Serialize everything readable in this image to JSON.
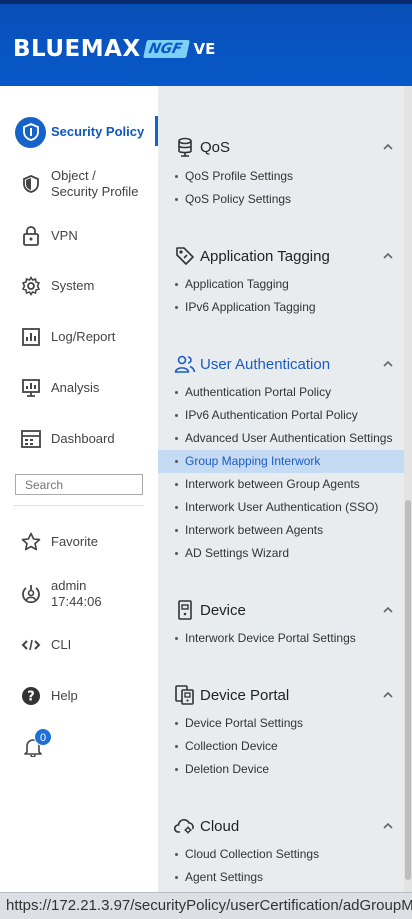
{
  "header": {
    "logo_main": "BLUEMAX",
    "logo_ngf": "NGF",
    "logo_ve": "VE"
  },
  "sidebar": {
    "items": [
      {
        "label": "Security Policy",
        "icon": "shield-icon"
      },
      {
        "label_line1": "Object /",
        "label_line2": "Security Profile",
        "icon": "object-shield-icon"
      },
      {
        "label": "VPN",
        "icon": "lock-icon"
      },
      {
        "label": "System",
        "icon": "gear-icon"
      },
      {
        "label": "Log/Report",
        "icon": "report-icon"
      },
      {
        "label": "Analysis",
        "icon": "analysis-icon"
      },
      {
        "label": "Dashboard",
        "icon": "dashboard-icon"
      }
    ],
    "search_placeholder": "Search",
    "favorite": "Favorite",
    "user_name": "admin",
    "user_time": "17:44:06",
    "cli": "CLI",
    "help": "Help",
    "notification_count": "0"
  },
  "panel": {
    "sections": [
      {
        "title": "QoS",
        "items": [
          "QoS Profile Settings",
          "QoS Policy Settings"
        ]
      },
      {
        "title": "Application Tagging",
        "items": [
          "Application Tagging",
          "IPv6 Application Tagging"
        ]
      },
      {
        "title": "User Authentication",
        "items": [
          "Authentication Portal Policy",
          "IPv6 Authentication Portal Policy",
          "Advanced User Authentication Settings",
          "Group Mapping Interwork",
          "Interwork between Group Agents",
          "Interwork User Authentication (SSO)",
          "Interwork between Agents",
          "AD Settings Wizard"
        ]
      },
      {
        "title": "Device",
        "items": [
          "Interwork Device Portal Settings"
        ]
      },
      {
        "title": "Device Portal",
        "items": [
          "Device Portal Settings",
          "Collection Device",
          "Deletion Device"
        ]
      },
      {
        "title": "Cloud",
        "items": [
          "Cloud Collection Settings",
          "Agent Settings"
        ]
      }
    ]
  },
  "statusbar": {
    "url": "https://172.21.3.97/securityPolicy/userCertification/adGroupM"
  },
  "colors": {
    "header_blue": "#0758c9",
    "accent_blue": "#1563c9",
    "selected_bg": "#c5daf3",
    "panel_bg": "#e9ecee"
  }
}
